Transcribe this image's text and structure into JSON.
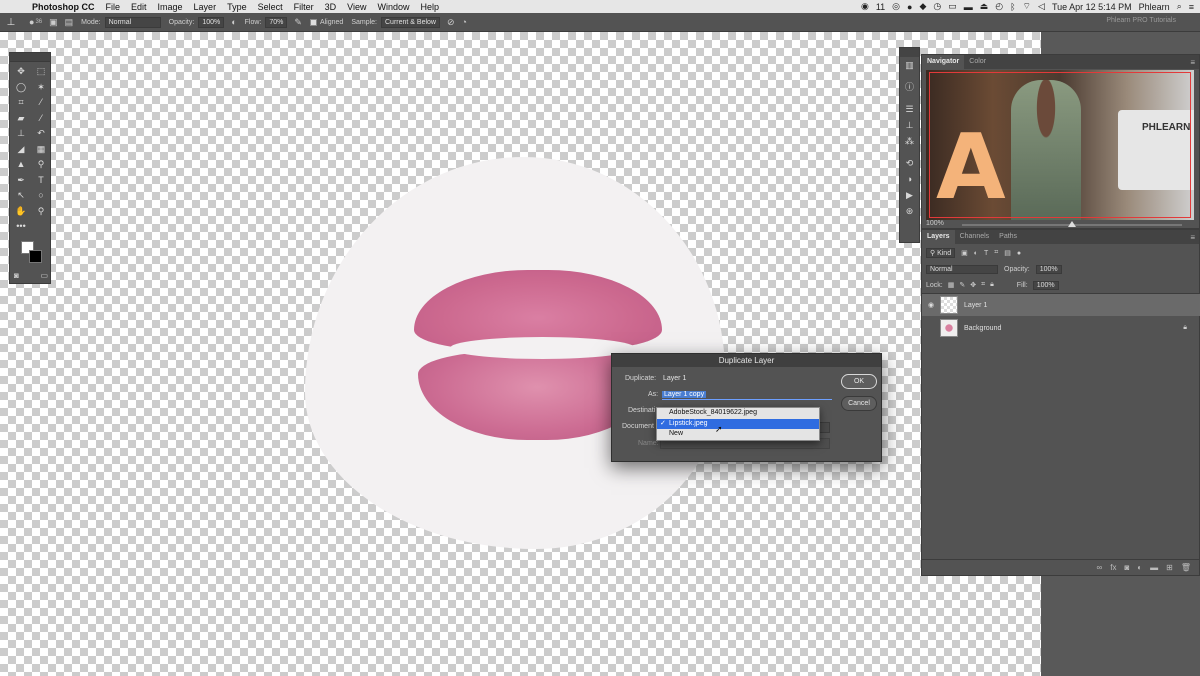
{
  "menubar": {
    "app_name": "Photoshop CC",
    "items": [
      "File",
      "Edit",
      "Image",
      "Layer",
      "Type",
      "Select",
      "Filter",
      "3D",
      "View",
      "Window",
      "Help"
    ],
    "notifications": "11",
    "datetime": "Tue Apr 12  5:14 PM",
    "user": "Phlearn"
  },
  "optionsbar": {
    "brush_size": "36",
    "mode_label": "Mode:",
    "mode_value": "Normal",
    "opacity_label": "Opacity:",
    "opacity_value": "100%",
    "flow_label": "Flow:",
    "flow_value": "70%",
    "aligned_label": "Aligned",
    "sample_label": "Sample:",
    "sample_value": "Current & Below",
    "workspace": "Phlearn PRO Tutorials"
  },
  "navigator": {
    "tabs": [
      "Navigator",
      "Color"
    ],
    "zoom": "100%",
    "zoom_fraction": 0.5,
    "preview_text": "PHLEARN"
  },
  "layers_panel": {
    "tabs": [
      "Layers",
      "Channels",
      "Paths"
    ],
    "filter_kind": "Kind",
    "blend_mode": "Normal",
    "opacity_label": "Opacity:",
    "opacity_value": "100%",
    "lock_label": "Lock:",
    "fill_label": "Fill:",
    "fill_value": "100%",
    "layers": [
      {
        "name": "Layer 1",
        "selected": true
      },
      {
        "name": "Background",
        "selected": false,
        "locked": true
      }
    ]
  },
  "dialog": {
    "title": "Duplicate Layer",
    "duplicate_label": "Duplicate:",
    "duplicate_value": "Layer 1",
    "as_label": "As:",
    "as_value": "Layer 1 copy",
    "destination_label": "Destinati",
    "document_label": "Document",
    "name_label": "Name:",
    "ok_label": "OK",
    "cancel_label": "Cancel"
  },
  "dropdown": {
    "options": [
      {
        "label": "AdobeStock_84019622.jpeg",
        "selected": false
      },
      {
        "label": "Lipstick.jpeg",
        "selected": true
      },
      {
        "label": "New",
        "selected": false
      }
    ],
    "check_mark": "✓"
  }
}
